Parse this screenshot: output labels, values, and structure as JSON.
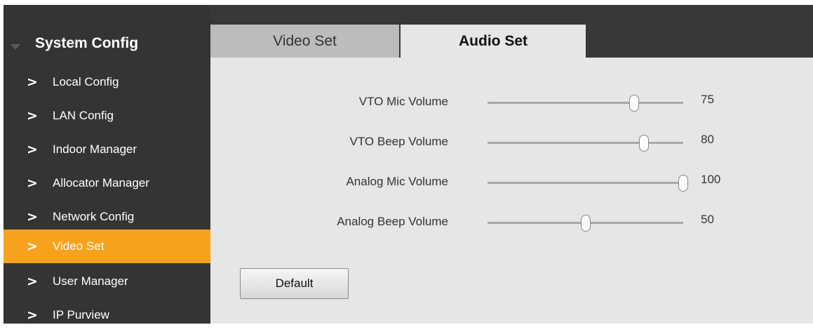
{
  "sidebar": {
    "title": "System Config",
    "items": [
      {
        "label": "Local Config",
        "active": false
      },
      {
        "label": "LAN Config",
        "active": false
      },
      {
        "label": "Indoor Manager",
        "active": false
      },
      {
        "label": "Allocator Manager",
        "active": false
      },
      {
        "label": "Network Config",
        "active": false
      },
      {
        "label": "Video Set",
        "active": true
      },
      {
        "label": "User Manager",
        "active": false
      },
      {
        "label": "IP Purview",
        "active": false
      }
    ],
    "chevron": ">"
  },
  "tabs": {
    "video_label": "Video Set",
    "audio_label": "Audio Set",
    "active": "Audio Set"
  },
  "audio": {
    "settings": [
      {
        "label": "VTO Mic Volume",
        "value": "75",
        "percent": 75
      },
      {
        "label": "VTO Beep Volume",
        "value": "80",
        "percent": 80
      },
      {
        "label": "Analog Mic Volume",
        "value": "100",
        "percent": 100
      },
      {
        "label": "Analog Beep Volume",
        "value": "50",
        "percent": 50
      }
    ],
    "default_label": "Default"
  },
  "colors": {
    "sidebar_bg": "#343434",
    "active_item": "#f7a21c",
    "content_bg": "#e6e6e6"
  }
}
